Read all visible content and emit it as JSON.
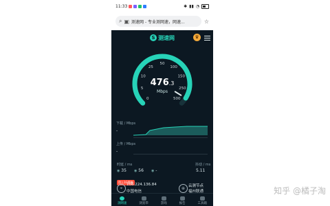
{
  "status": {
    "time": "11:33"
  },
  "browser": {
    "url_text": "测速网 - 专业测网速，网速..."
  },
  "app": {
    "logo_text": "测速网"
  },
  "gauge": {
    "ticks": [
      "0",
      "5",
      "10",
      "25",
      "50",
      "100",
      "150",
      "250",
      "500"
    ],
    "value_main": "476",
    "value_decimal": ".3",
    "unit": "Mbps",
    "fill_fraction": 0.95
  },
  "graphs": {
    "download_label": "下载 / Mbps",
    "download_value": "-",
    "upload_label": "上传 / Mbps",
    "upload_value": "-"
  },
  "stats": {
    "latency_label": "时延 / ms",
    "jitter_label": "抖动 / ms",
    "ping_value": "35",
    "jitter_value": "56",
    "third_value": "-",
    "extra_value": "5.11"
  },
  "network": {
    "ip": "106.224.136.84",
    "isp": "中国电信",
    "server_label": "云测节点",
    "server_name": "福州联通",
    "promo_chip": "用上1G宽带"
  },
  "nav": {
    "items": [
      "测网速",
      "测宽带",
      "游戏",
      "报告",
      "工具箱"
    ],
    "active_index": 0
  },
  "watermark": {
    "text": "知乎 @橘子淘"
  },
  "colors": {
    "accent": "#27d3b8",
    "background": "#0c1822"
  }
}
